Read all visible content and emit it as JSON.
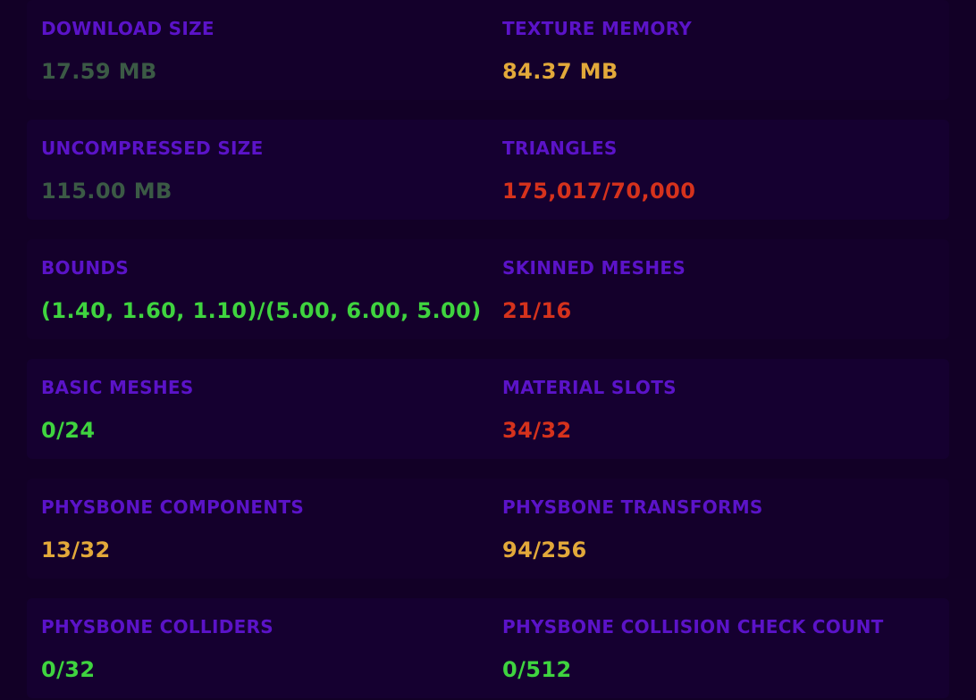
{
  "colors": {
    "background": "#120026",
    "label": "#5b13c8",
    "muted": "#3b5a45",
    "good": "#3fd43f",
    "warning": "#e2a93a",
    "bad": "#d5321c"
  },
  "stats": [
    {
      "left": {
        "label": "DOWNLOAD SIZE",
        "value": "17.59 MB",
        "status": "muted"
      },
      "right": {
        "label": "TEXTURE MEMORY",
        "value": "84.37 MB",
        "status": "warning"
      }
    },
    {
      "left": {
        "label": "UNCOMPRESSED SIZE",
        "value": "115.00 MB",
        "status": "muted"
      },
      "right": {
        "label": "TRIANGLES",
        "value": "175,017/70,000",
        "status": "bad"
      }
    },
    {
      "left": {
        "label": "BOUNDS",
        "value": "(1.40, 1.60, 1.10)/(5.00, 6.00, 5.00)",
        "status": "good"
      },
      "right": {
        "label": "SKINNED MESHES",
        "value": "21/16",
        "status": "bad"
      }
    },
    {
      "left": {
        "label": "BASIC MESHES",
        "value": "0/24",
        "status": "good"
      },
      "right": {
        "label": "MATERIAL SLOTS",
        "value": "34/32",
        "status": "bad"
      }
    },
    {
      "left": {
        "label": "PHYSBONE COMPONENTS",
        "value": "13/32",
        "status": "warning"
      },
      "right": {
        "label": "PHYSBONE TRANSFORMS",
        "value": "94/256",
        "status": "warning"
      }
    },
    {
      "left": {
        "label": "PHYSBONE COLLIDERS",
        "value": "0/32",
        "status": "good"
      },
      "right": {
        "label": "PHYSBONE COLLISION CHECK COUNT",
        "value": "0/512",
        "status": "good"
      }
    }
  ]
}
